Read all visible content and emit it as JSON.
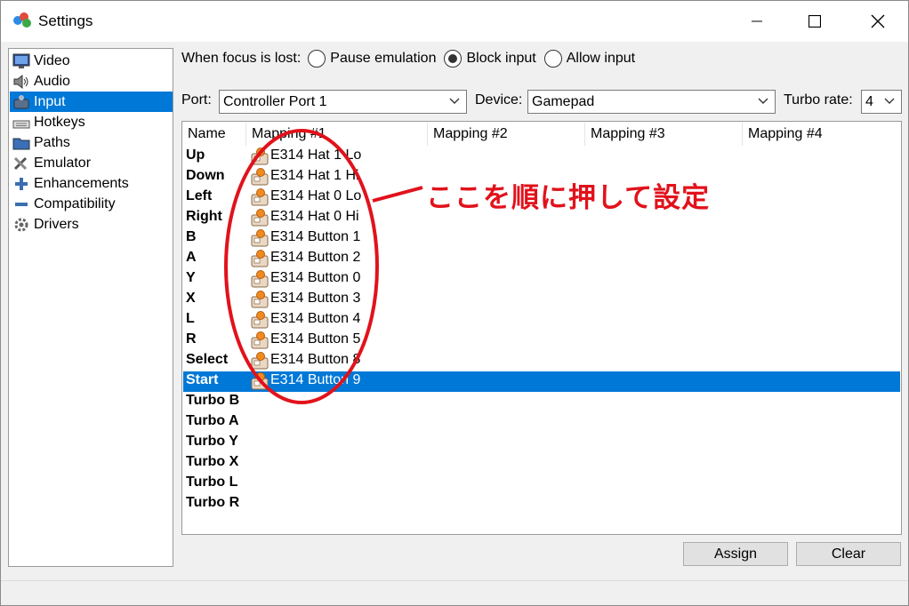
{
  "window": {
    "title": "Settings"
  },
  "sidebar": {
    "items": [
      {
        "label": "Video",
        "icon": "video-icon"
      },
      {
        "label": "Audio",
        "icon": "audio-icon"
      },
      {
        "label": "Input",
        "icon": "input-icon",
        "selected": true
      },
      {
        "label": "Hotkeys",
        "icon": "keyboard-icon"
      },
      {
        "label": "Paths",
        "icon": "folder-icon"
      },
      {
        "label": "Emulator",
        "icon": "tools-icon"
      },
      {
        "label": "Enhancements",
        "icon": "plus-icon"
      },
      {
        "label": "Compatibility",
        "icon": "minus-icon"
      },
      {
        "label": "Drivers",
        "icon": "gear-icon"
      }
    ]
  },
  "focus": {
    "label": "When focus is lost:",
    "options": [
      "Pause emulation",
      "Block input",
      "Allow input"
    ],
    "selected": "Block input"
  },
  "port": {
    "label": "Port:",
    "value": "Controller Port 1"
  },
  "device": {
    "label": "Device:",
    "value": "Gamepad"
  },
  "turbo": {
    "label": "Turbo rate:",
    "value": "4"
  },
  "table": {
    "headers": [
      "Name",
      "Mapping #1",
      "Mapping #2",
      "Mapping #3",
      "Mapping #4"
    ],
    "rows": [
      {
        "name": "Up",
        "mapping": "E314 Hat 1 Lo"
      },
      {
        "name": "Down",
        "mapping": "E314 Hat 1 Hi"
      },
      {
        "name": "Left",
        "mapping": "E314 Hat 0 Lo"
      },
      {
        "name": "Right",
        "mapping": "E314 Hat 0 Hi"
      },
      {
        "name": "B",
        "mapping": "E314 Button 1"
      },
      {
        "name": "A",
        "mapping": "E314 Button 2"
      },
      {
        "name": "Y",
        "mapping": "E314 Button 0"
      },
      {
        "name": "X",
        "mapping": "E314 Button 3"
      },
      {
        "name": "L",
        "mapping": "E314 Button 4"
      },
      {
        "name": "R",
        "mapping": "E314 Button 5"
      },
      {
        "name": "Select",
        "mapping": "E314 Button 8"
      },
      {
        "name": "Start",
        "mapping": "E314 Button 9",
        "selected": true
      },
      {
        "name": "Turbo B",
        "mapping": ""
      },
      {
        "name": "Turbo A",
        "mapping": ""
      },
      {
        "name": "Turbo Y",
        "mapping": ""
      },
      {
        "name": "Turbo X",
        "mapping": ""
      },
      {
        "name": "Turbo L",
        "mapping": ""
      },
      {
        "name": "Turbo R",
        "mapping": ""
      }
    ]
  },
  "annotation": {
    "text": "ここを順に押して設定",
    "color": "#e1121b"
  },
  "buttons": {
    "assign": "Assign",
    "clear": "Clear"
  },
  "colors": {
    "selection": "#0078d7",
    "annotation": "#e1121b"
  }
}
